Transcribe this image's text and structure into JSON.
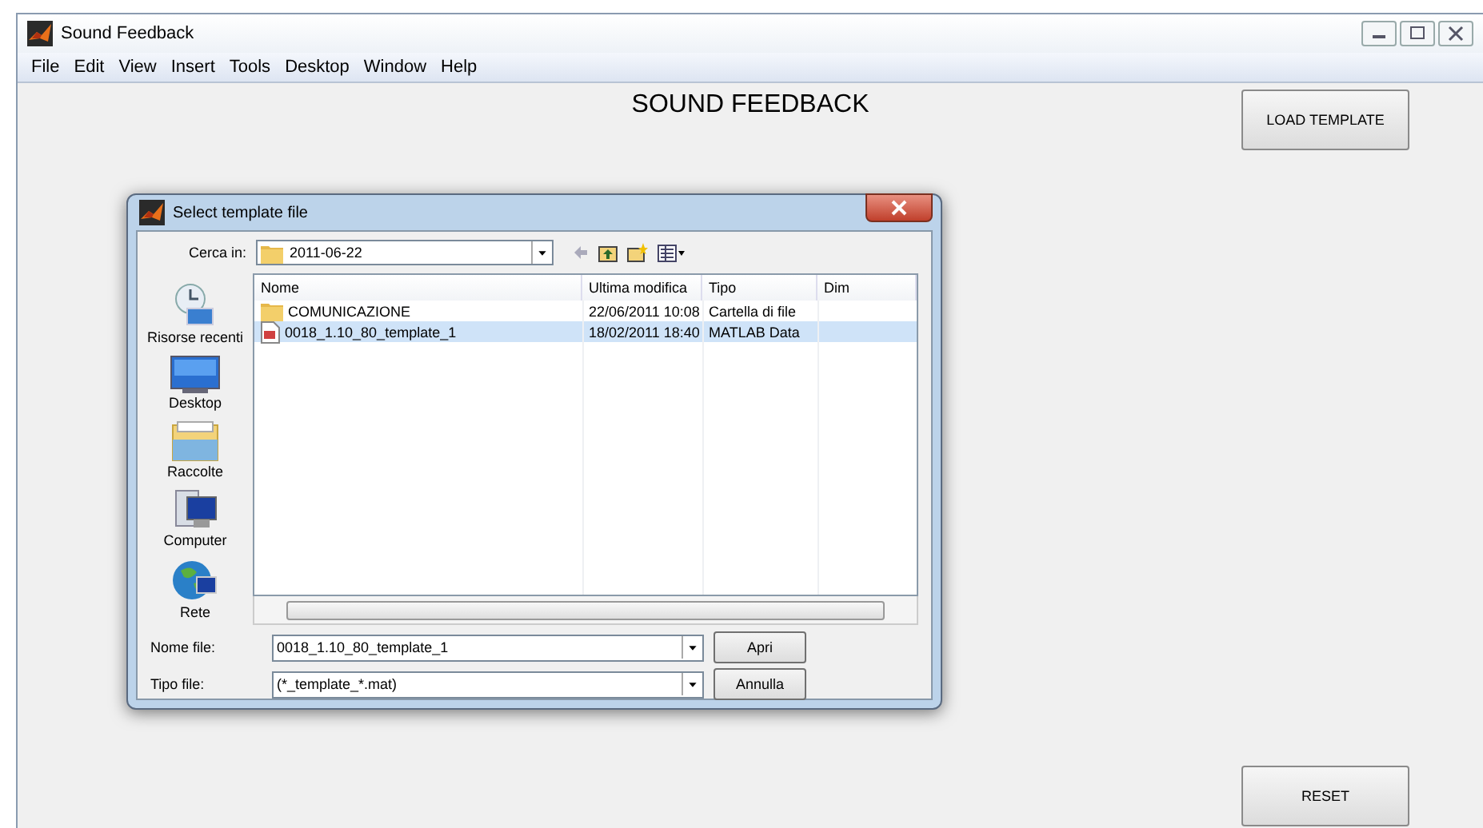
{
  "window": {
    "title": "Sound Feedback"
  },
  "menu": [
    "File",
    "Edit",
    "View",
    "Insert",
    "Tools",
    "Desktop",
    "Window",
    "Help"
  ],
  "heading": "SOUND FEEDBACK",
  "load_button": "LOAD TEMPLATE",
  "reset_button": "RESET",
  "dialog": {
    "title": "Select template file",
    "look_in_label": "Cerca in:",
    "look_in_value": "2011-06-22",
    "places": [
      {
        "label": "Risorse recenti",
        "kind": "recent"
      },
      {
        "label": "Desktop",
        "kind": "desktop"
      },
      {
        "label": "Raccolte",
        "kind": "libraries"
      },
      {
        "label": "Computer",
        "kind": "computer"
      },
      {
        "label": "Rete",
        "kind": "network"
      }
    ],
    "columns": [
      "Nome",
      "Ultima modifica",
      "Tipo",
      "Dim"
    ],
    "rows": [
      {
        "kind": "folder",
        "name": "COMUNICAZIONE",
        "modified": "22/06/2011 10:08",
        "type": "Cartella di file",
        "selected": false
      },
      {
        "kind": "file",
        "name": "0018_1.10_80_template_1",
        "modified": "18/02/2011 18:40",
        "type": "MATLAB Data",
        "selected": true
      }
    ],
    "file_name_label": "Nome file:",
    "file_name_value": "0018_1.10_80_template_1",
    "file_type_label": "Tipo file:",
    "file_type_value": "(*_template_*.mat)",
    "open_button": "Apri",
    "cancel_button": "Annulla"
  }
}
